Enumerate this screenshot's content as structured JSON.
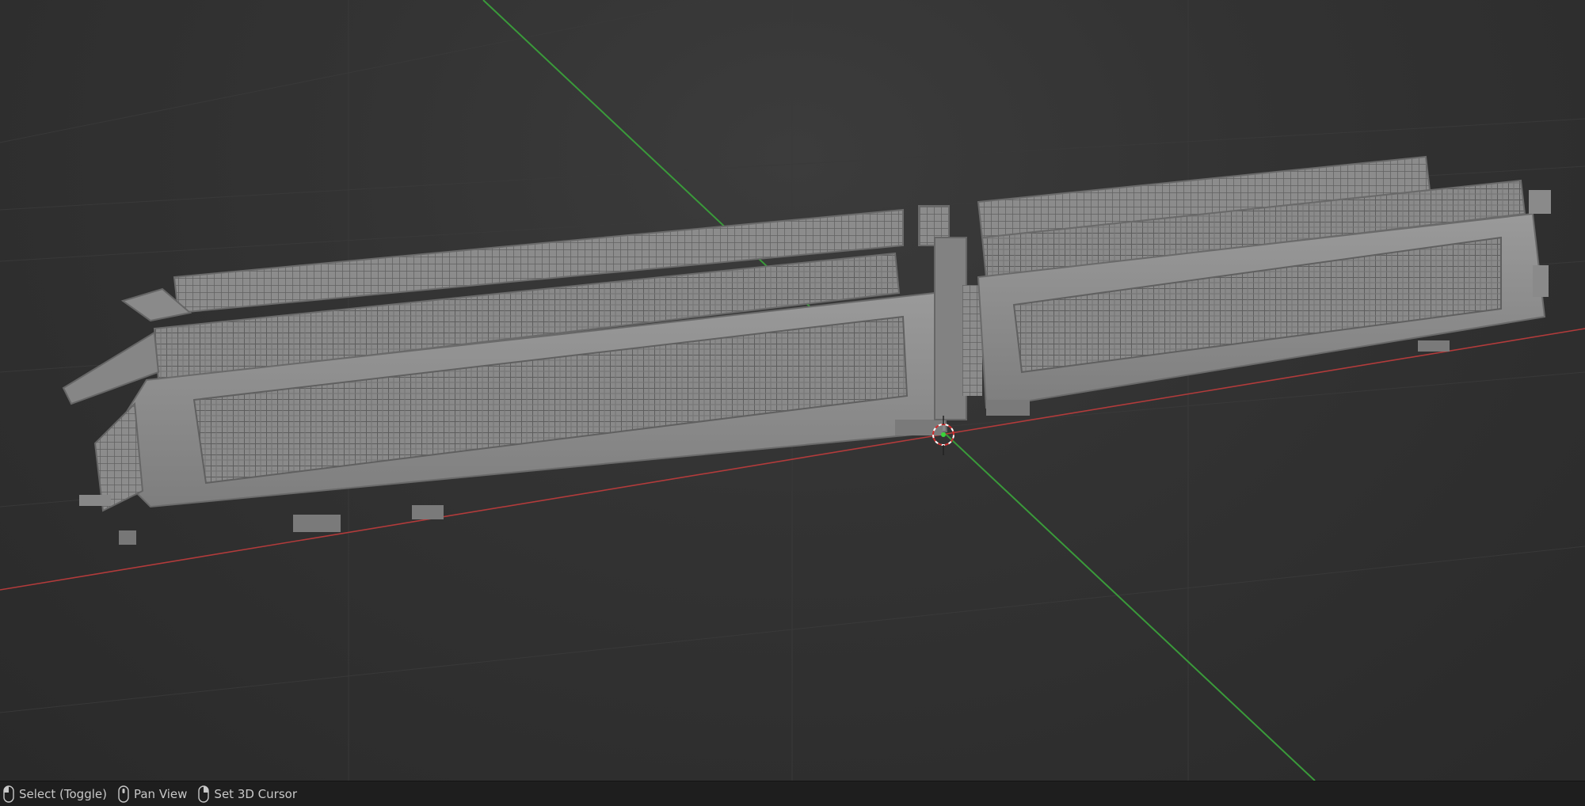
{
  "viewport": {
    "background": "#303030",
    "axis_x_color": "#b23b3b",
    "axis_y_color": "#3a9a3a",
    "model_color": "#8d8d8d",
    "cursor_icon": "3d-cursor-icon"
  },
  "statusbar": {
    "hints": [
      {
        "icon": "mouse-left-icon",
        "label": "Select (Toggle)"
      },
      {
        "icon": "mouse-middle-icon",
        "label": "Pan View"
      },
      {
        "icon": "mouse-right-icon",
        "label": "Set 3D Cursor"
      }
    ]
  }
}
